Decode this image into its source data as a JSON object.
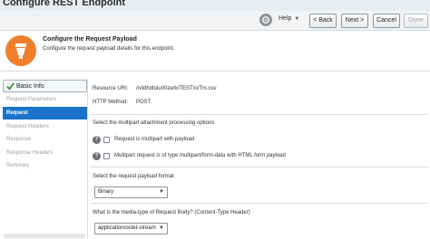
{
  "window": {
    "title": "Configure REST Endpoint"
  },
  "toolbar": {
    "help_label": "Help",
    "back_label": "< Back",
    "next_label": "Next >",
    "cancel_label": "Cancel",
    "done_label": "Done"
  },
  "header": {
    "title": "Configure the Request Payload",
    "description": "Configure the request payload details for this endpoint."
  },
  "nav": {
    "items": [
      {
        "label": "Basic Info"
      },
      {
        "label": "Request Parameters"
      },
      {
        "label": "Request"
      },
      {
        "label": "Request Headers"
      },
      {
        "label": "Response"
      },
      {
        "label": "Response Headers"
      },
      {
        "label": "Summary"
      }
    ]
  },
  "main": {
    "resource_uri_label": "Resource URI:",
    "resource_uri_value": "/n/idhdtoiu00ze/b/TEST/o/Trx.csv",
    "http_method_label": "HTTP Method:",
    "http_method_value": "POST",
    "multipart_heading": "Select the multipart attachment processing options",
    "multipart_option1": "Request is multipart with payload",
    "multipart_option2": "Multipart request is of type multipart/form-data with HTML form payload",
    "payload_format_heading": "Select the request payload format",
    "payload_format_value": "Binary",
    "media_type_heading": "What is the media-type of Request Body? (Content-Type Header)",
    "media_type_value": "application/octet-stream"
  },
  "colors": {
    "accent": "#1a73c8",
    "header_icon": "#f07f2d"
  }
}
